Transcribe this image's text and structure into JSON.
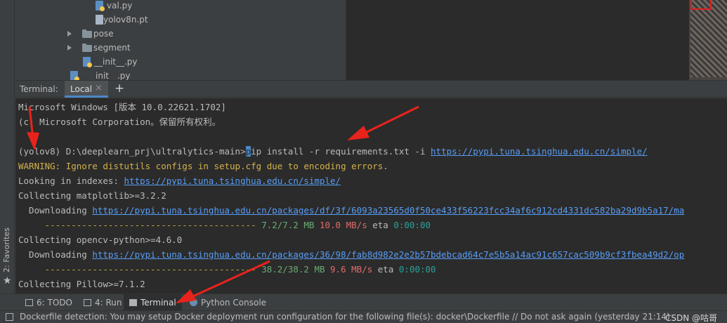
{
  "project_tree": {
    "items": [
      {
        "label": "val.py",
        "icon": "python-file-icon"
      },
      {
        "label": "yolov8n.pt",
        "icon": "file-icon"
      },
      {
        "label": "pose",
        "icon": "folder-icon"
      },
      {
        "label": "segment",
        "icon": "folder-icon"
      },
      {
        "label": "__init__.py",
        "icon": "python-file-icon"
      },
      {
        "label": "__init__.py",
        "icon": "python-file-icon"
      }
    ]
  },
  "terminal": {
    "label": "Terminal:",
    "tab": "Local",
    "close_glyph": "×",
    "new_tab_glyph": "+",
    "lines": {
      "l1": "Microsoft Windows [版本 10.0.22621.1702]",
      "l2": "(c) Microsoft Corporation。保留所有权利。",
      "prompt": "(yolov8) D:\\deeplearn_prj\\ultralytics-main>",
      "cmd_first_char": "p",
      "cmd": "ip install -r requirements.txt -i ",
      "cmd_url": "https://pypi.tuna.tsinghua.edu.cn/simple/",
      "warning": "WARNING: Ignore distutils configs in setup.cfg due to encoding errors.",
      "looking_prefix": "Looking in indexes: ",
      "looking_url": "https://pypi.tuna.tsinghua.edu.cn/simple/",
      "collect1": "Collecting matplotlib>=3.2.2",
      "dl_prefix": "  Downloading ",
      "dl1_url": "https://pypi.tuna.tsinghua.edu.cn/packages/df/3f/6093a23565d0f50ce433f56223fcc34af6c912cd4331dc582ba29d9b5a17/ma",
      "bar1": "     ---------------------------------------- ",
      "size1": "7.2/7.2 MB",
      "speed1": "10.0 MB/s",
      "eta_label": "eta",
      "eta1": "0:00:00",
      "collect2": "Collecting opencv-python>=4.6.0",
      "dl2_url": "https://pypi.tuna.tsinghua.edu.cn/packages/36/98/fab8d982e2e2b57bdebcad64c7e5b5a14ac91c657cac509b9cf3fbea49d2/op",
      "bar2": "     ---------------------------------------- ",
      "size2": "38.2/38.2 MB",
      "speed2": "9.6 MB/s",
      "eta2": "0:00:00",
      "collect3": "Collecting Pillow>=7.1.2"
    }
  },
  "left_strip": {
    "favorites": "2: Favorites"
  },
  "tool_windows": {
    "todo": "6: TODO",
    "run": "4: Run",
    "terminal": "Terminal",
    "python_console": "Python Console"
  },
  "status_bar": {
    "message": "Dockerfile detection: You may setup Docker deployment run configuration for the following file(s): docker\\Dockerfile // Do not ask again (yesterday 21:14)",
    "watermark": "CSDN @咕哥"
  },
  "colors": {
    "link": "#589df6",
    "warning": "#d4b14a",
    "progress": "#b9b033",
    "accent": "#4a88c7",
    "arrow": "#e8231c"
  }
}
